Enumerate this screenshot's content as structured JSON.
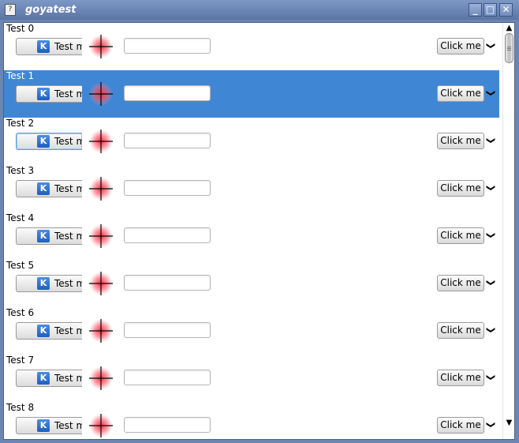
{
  "window": {
    "title": "goyatest"
  },
  "rows": [
    {
      "label": "Test 0",
      "button": "Test m",
      "action": "Click me",
      "input_value": ""
    },
    {
      "label": "Test 1",
      "button": "Test m",
      "action": "Click me",
      "input_value": ""
    },
    {
      "label": "Test 2",
      "button": "Test m",
      "action": "Click me",
      "input_value": ""
    },
    {
      "label": "Test 3",
      "button": "Test m",
      "action": "Click me",
      "input_value": ""
    },
    {
      "label": "Test 4",
      "button": "Test m",
      "action": "Click me",
      "input_value": ""
    },
    {
      "label": "Test 5",
      "button": "Test m",
      "action": "Click me",
      "input_value": ""
    },
    {
      "label": "Test 6",
      "button": "Test m",
      "action": "Click me",
      "input_value": ""
    },
    {
      "label": "Test 7",
      "button": "Test m",
      "action": "Click me",
      "input_value": ""
    },
    {
      "label": "Test 8",
      "button": "Test m",
      "action": "Click me",
      "input_value": ""
    }
  ],
  "selected_row": 1,
  "focused_row": 2,
  "icons": {
    "row_button_icon": "kde-icon",
    "marker": "crosshair-icon"
  },
  "colors": {
    "selection": "#3f87d4",
    "titlebar": "#6c86b4"
  }
}
